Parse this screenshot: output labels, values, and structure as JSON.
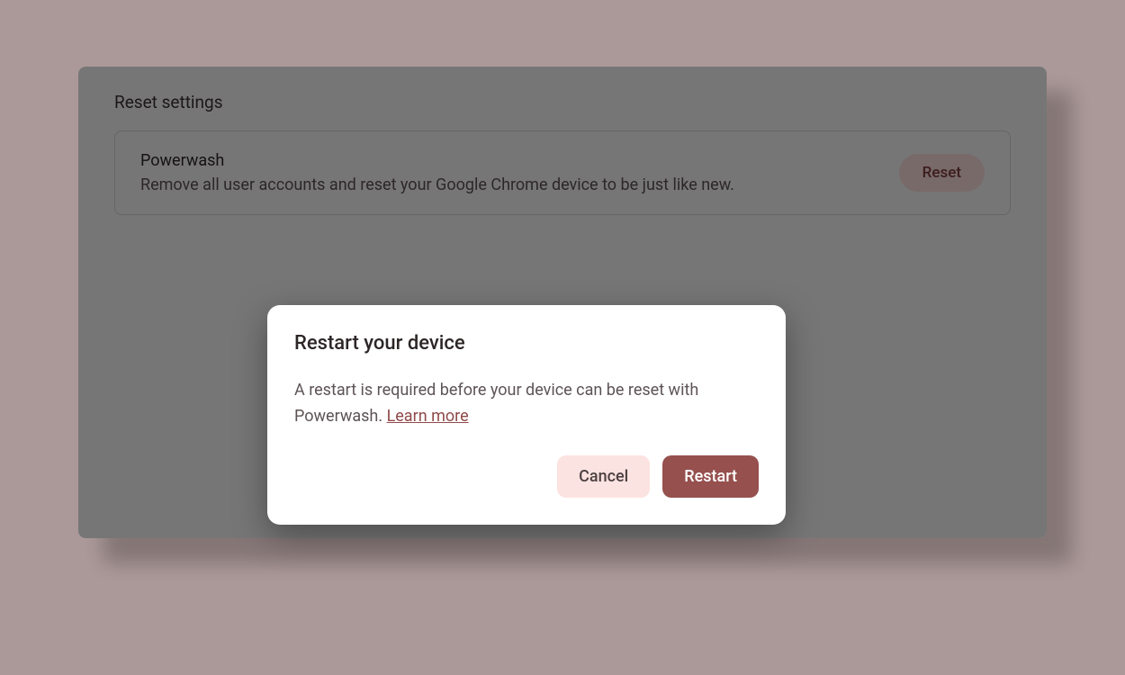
{
  "section": {
    "title": "Reset settings"
  },
  "powerwash": {
    "title": "Powerwash",
    "description": "Remove all user accounts and reset your Google Chrome device to be just like new.",
    "reset_label": "Reset"
  },
  "dialog": {
    "title": "Restart your device",
    "body_text": "A restart is required before your device can be reset with Powerwash. ",
    "learn_more_label": "Learn more",
    "cancel_label": "Cancel",
    "restart_label": "Restart"
  }
}
